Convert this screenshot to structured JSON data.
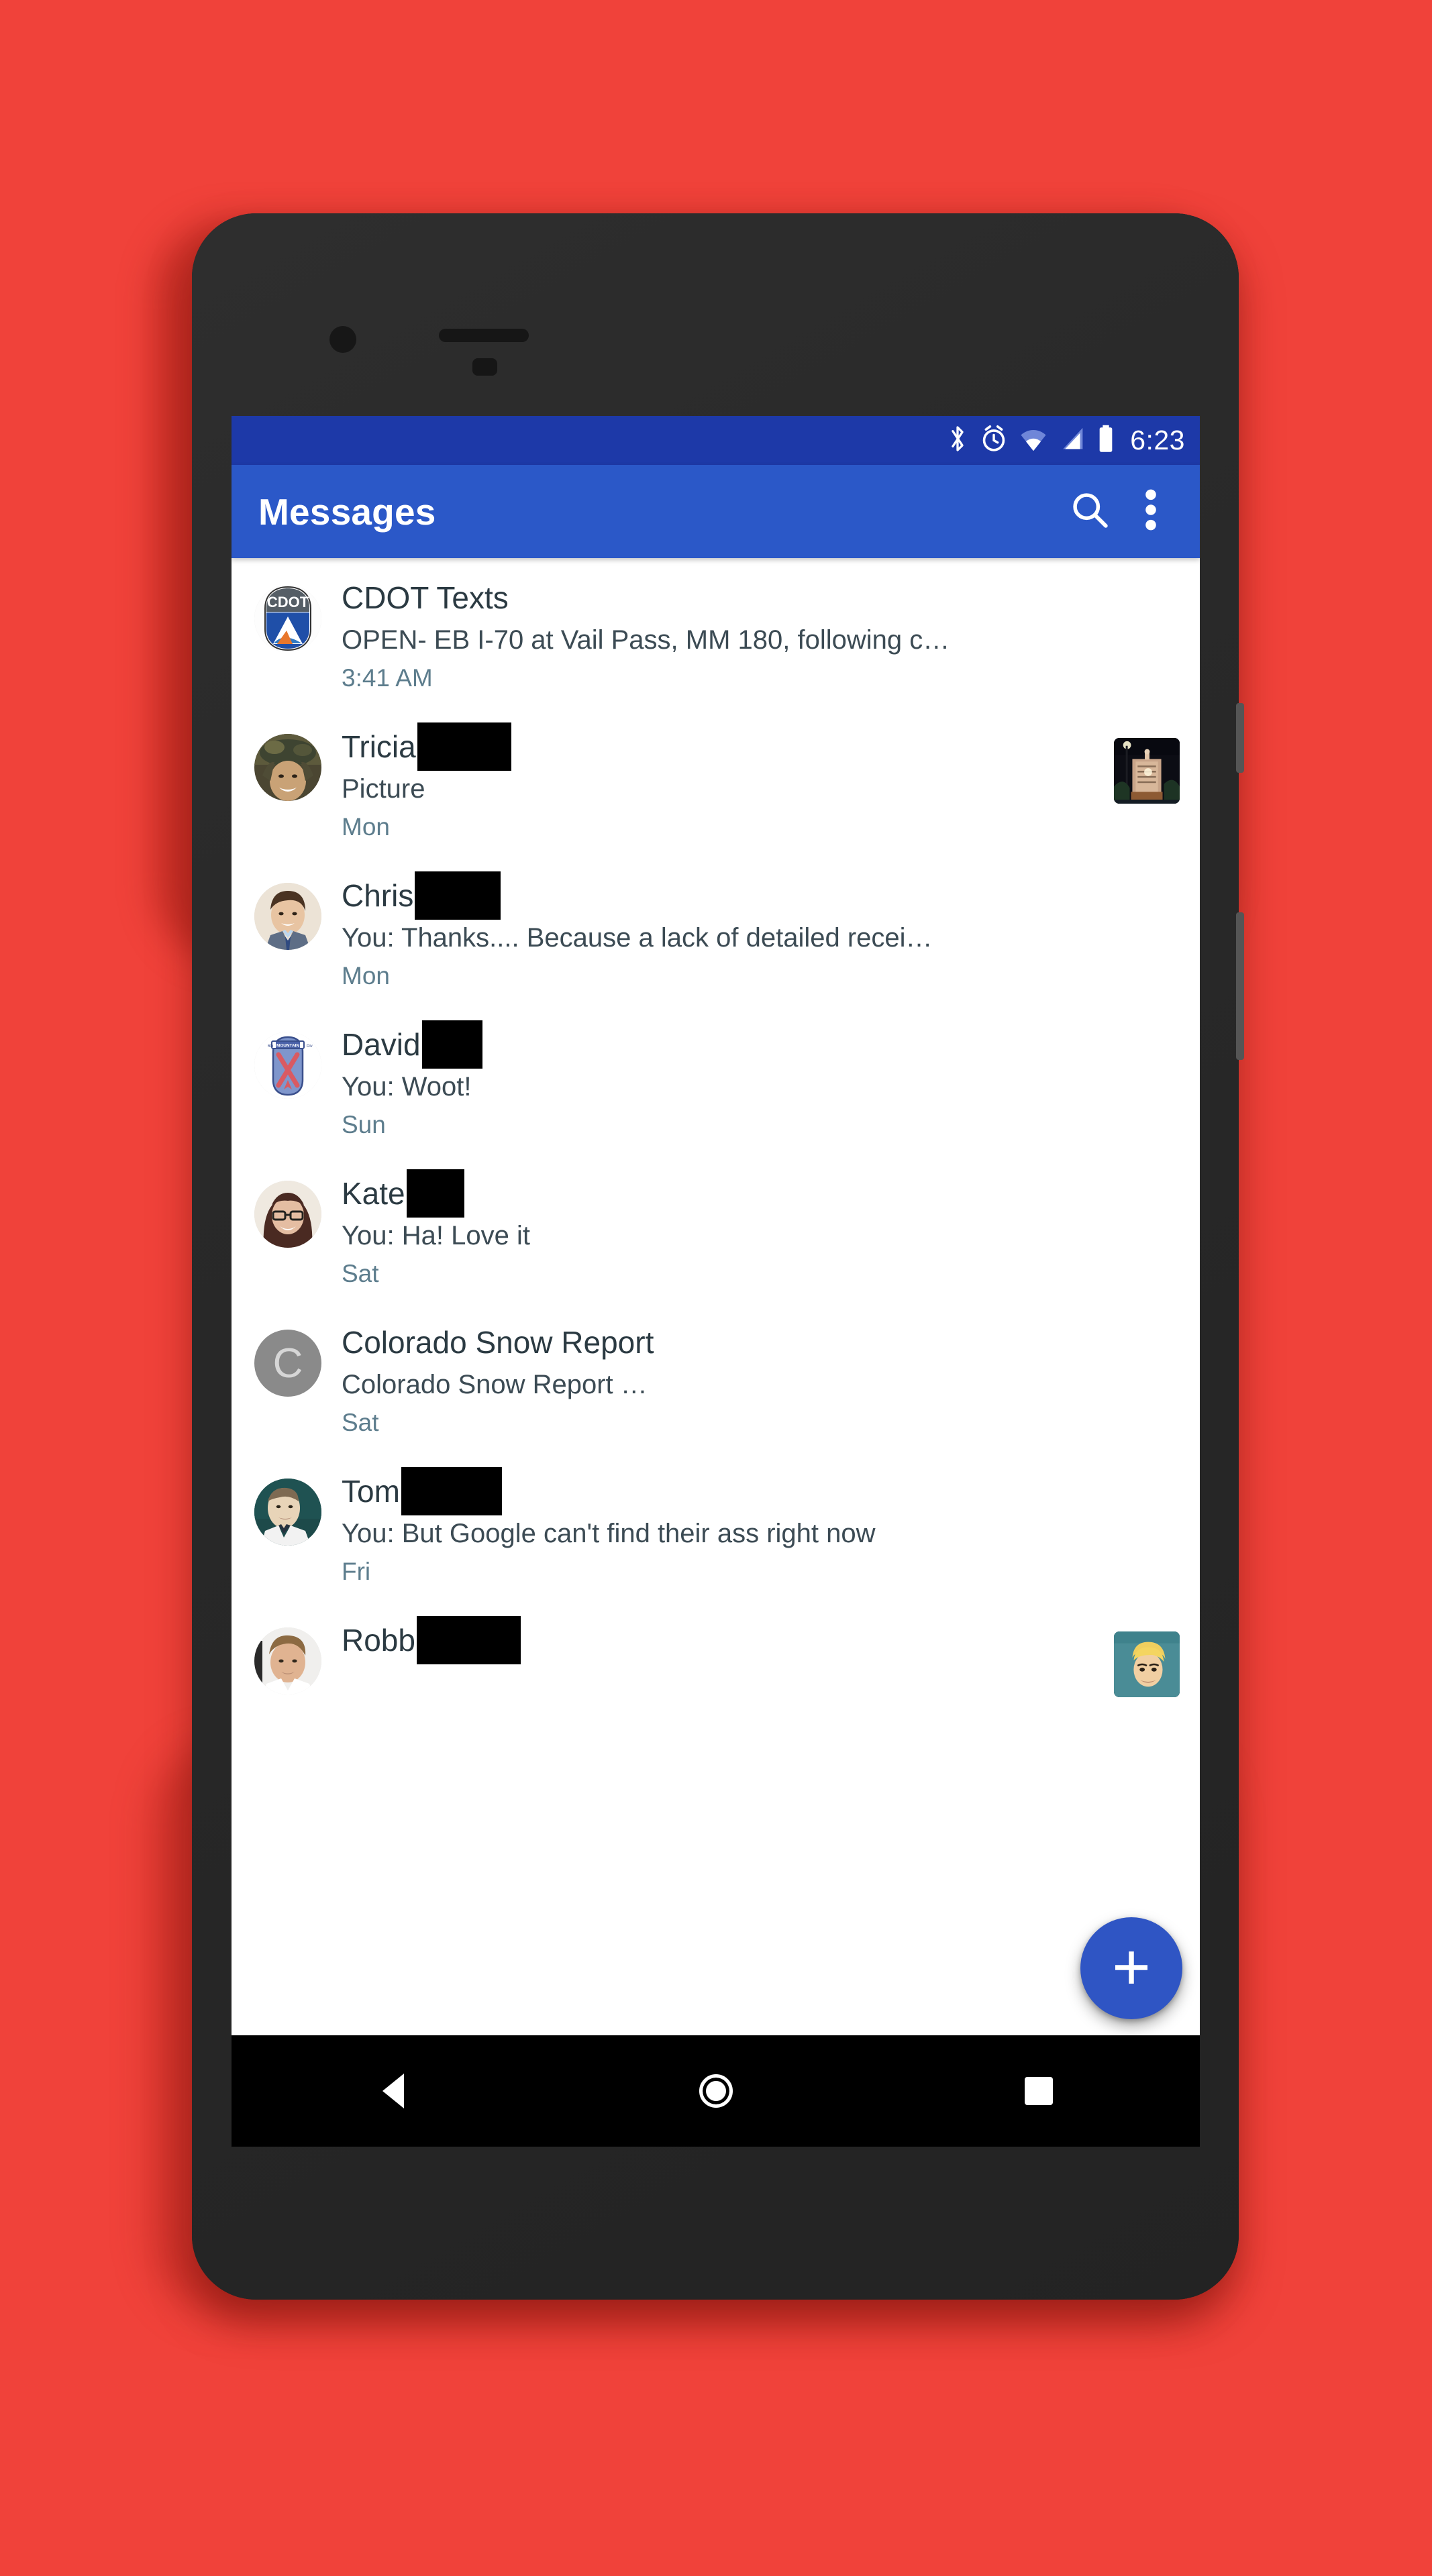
{
  "theme": {
    "background_color": "#F0423A",
    "status_bar_color": "#1D39A8",
    "app_bar_color": "#2B58C8",
    "fab_color": "#2F55C4",
    "nav_bar_color": "#000000",
    "screen_background": "#FFFFFF",
    "time_text_color": "#5D7D8D",
    "device_body_color": "#262626"
  },
  "status_bar": {
    "clock": "6:23",
    "icons": [
      "bluetooth-icon",
      "alarm-icon",
      "wifi-icon",
      "cell-signal-icon",
      "battery-icon"
    ]
  },
  "app_bar": {
    "title": "Messages",
    "search_label": "Search",
    "overflow_label": "More options"
  },
  "fab": {
    "label": "+",
    "name": "Start new conversation"
  },
  "nav_bar": {
    "back_label": "Back",
    "home_label": "Home",
    "recents_label": "Recents"
  },
  "conversations": [
    {
      "name": "CDOT Texts",
      "redaction_width": 0,
      "snippet": "OPEN- EB I-70 at Vail Pass, MM 180, following c…",
      "time": "3:41 AM",
      "avatar_type": "cdot-logo",
      "avatar_letter": "",
      "thumbnail": false
    },
    {
      "name": "Tricia",
      "redaction_width": 140,
      "snippet": "Picture",
      "time": "Mon",
      "avatar_type": "photo-woman-hat",
      "avatar_letter": "",
      "thumbnail": true,
      "thumbnail_type": "night-hotel-photo"
    },
    {
      "name": "Chris",
      "redaction_width": 128,
      "snippet": "You: Thanks.... Because a lack of detailed recei…",
      "time": "Mon",
      "avatar_type": "photo-man-suit",
      "avatar_letter": "",
      "thumbnail": false
    },
    {
      "name": "David",
      "redaction_width": 90,
      "snippet": "You: Woot!",
      "time": "Sun",
      "avatar_type": "mountain-division-patch",
      "avatar_letter": "",
      "thumbnail": false
    },
    {
      "name": "Kate",
      "redaction_width": 86,
      "snippet": "You: Ha!  Love it",
      "time": "Sat",
      "avatar_type": "photo-woman-glasses",
      "avatar_letter": "",
      "thumbnail": false
    },
    {
      "name": "Colorado Snow Report",
      "redaction_width": 0,
      "snippet": "Colorado Snow Report …",
      "time": "Sat",
      "avatar_type": "letter",
      "avatar_letter": "C",
      "thumbnail": false
    },
    {
      "name": "Tom",
      "redaction_width": 150,
      "snippet": "You: But Google can't find their ass right now",
      "time": "Fri",
      "avatar_type": "photo-man-teal",
      "avatar_letter": "",
      "thumbnail": false
    },
    {
      "name": "Robb",
      "redaction_width": 155,
      "snippet": "",
      "time": "",
      "avatar_type": "photo-man-blond",
      "avatar_letter": "",
      "thumbnail": true,
      "thumbnail_type": "cartoon-blond-character"
    }
  ]
}
